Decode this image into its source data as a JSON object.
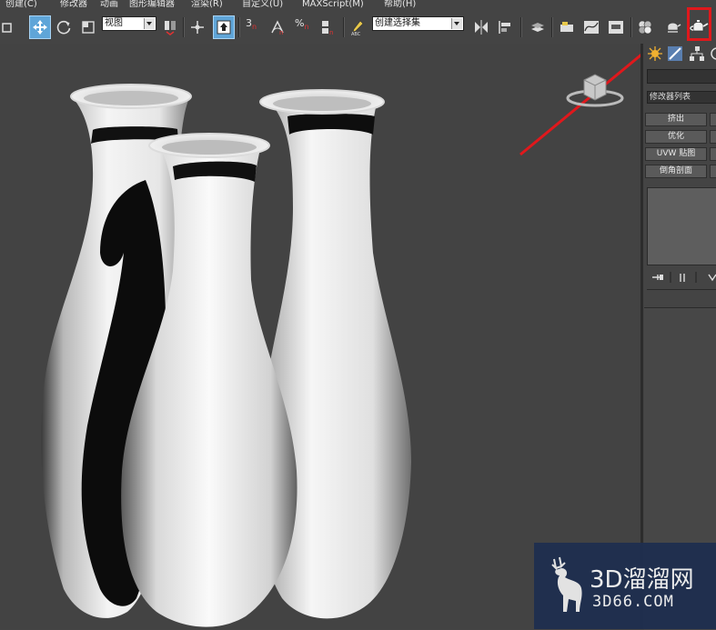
{
  "menu": {
    "items": [
      "创建(C)",
      "修改器",
      "动画",
      "图形编辑器",
      "渲染(R)",
      "自定义(U)",
      "MAXScript(M)",
      "帮助(H)"
    ]
  },
  "toolbar": {
    "view_dropdown": "视图",
    "selection_set_dropdown": "创建选择集",
    "snap_label": "3",
    "percent_label": "%"
  },
  "panel": {
    "modifier_list": "修改器列表",
    "buttons": [
      "挤出",
      "优化",
      "UVW 贴图",
      "倒角剖面"
    ]
  },
  "watermark": {
    "title": "3D溜溜网",
    "subtitle": "3D66.COM"
  },
  "colors": {
    "highlight": "#e0181c",
    "viewport_bg": "#434343",
    "active_tool": "#5fa5d8"
  }
}
